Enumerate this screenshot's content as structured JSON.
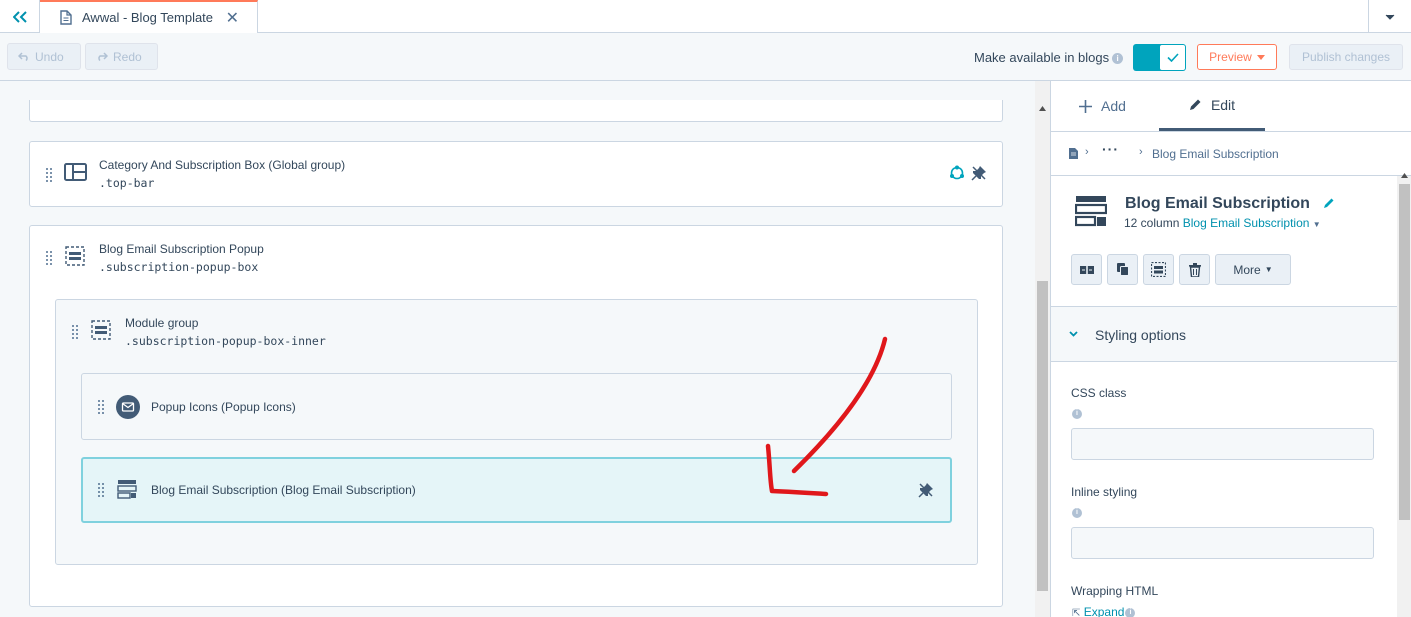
{
  "tab": {
    "title": "Awwal - Blog Template",
    "close": "✕"
  },
  "toolbar": {
    "undo": "Undo",
    "redo": "Redo",
    "make_available": "Make available in blogs",
    "preview": "Preview",
    "publish": "Publish changes",
    "toggle_on": true
  },
  "canvas": {
    "rows": [
      {
        "title": "Category And Subscription Box (Global group)",
        "css": ".top-bar"
      },
      {
        "title": "Blog Email Subscription Popup",
        "css": ".subscription-popup-box"
      },
      {
        "title": "Module group",
        "css": ".subscription-popup-box-inner"
      },
      {
        "title": "Popup Icons (Popup Icons)"
      },
      {
        "title": "Blog Email Subscription (Blog Email Subscription)",
        "selected": true
      }
    ]
  },
  "panel": {
    "tabs": [
      {
        "label": "Add"
      },
      {
        "label": "Edit",
        "active": true
      }
    ],
    "breadcrumb": {
      "ellipsis": "···",
      "current": "Blog Email Subscription"
    },
    "module": {
      "name": "Blog Email Subscription",
      "columns": "12 column",
      "type_link": "Blog Email Subscription"
    },
    "more": "More",
    "styling": "Styling options",
    "fields": {
      "css_class": "CSS class",
      "inline_styling": "Inline styling",
      "wrapping_html": "Wrapping HTML",
      "expand": "Expand"
    }
  },
  "colors": {
    "accent": "#00a4bd",
    "link": "#0091ae",
    "orange": "#ff7a59",
    "selected_bg": "#e5f5f8",
    "annotation": "#e0171b"
  }
}
